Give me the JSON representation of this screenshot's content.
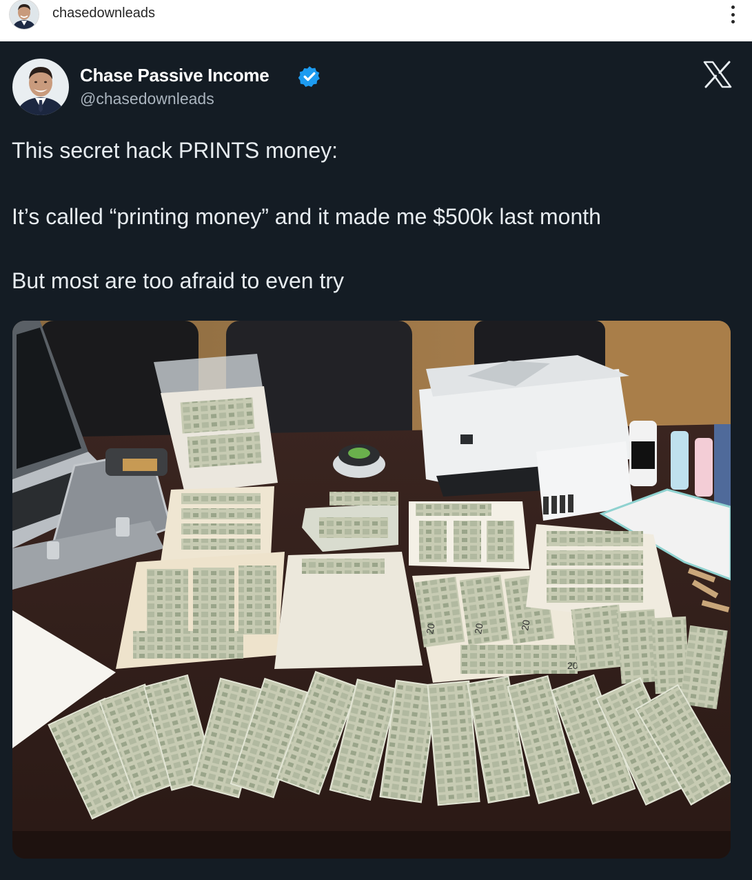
{
  "topbar": {
    "username": "chasedownleads",
    "avatar_icon": "profile-avatar-icon",
    "more_icon": "more-vertical-icon"
  },
  "post": {
    "author": {
      "display_name": "Chase Passive Income",
      "handle": "@chasedownleads",
      "verified_color": "#1d9bf0"
    },
    "platform_icon": "x-logo-icon",
    "text": {
      "line1": "This secret hack PRINTS money:",
      "line2": "It’s called “printing money” and it made me $500k last month",
      "line3": "But most are too afraid to even try"
    },
    "image": {
      "bill_label": "20"
    }
  },
  "colors": {
    "post_background": "#141c24",
    "text_primary": "#e7ecf0",
    "text_secondary": "#aab4be"
  }
}
